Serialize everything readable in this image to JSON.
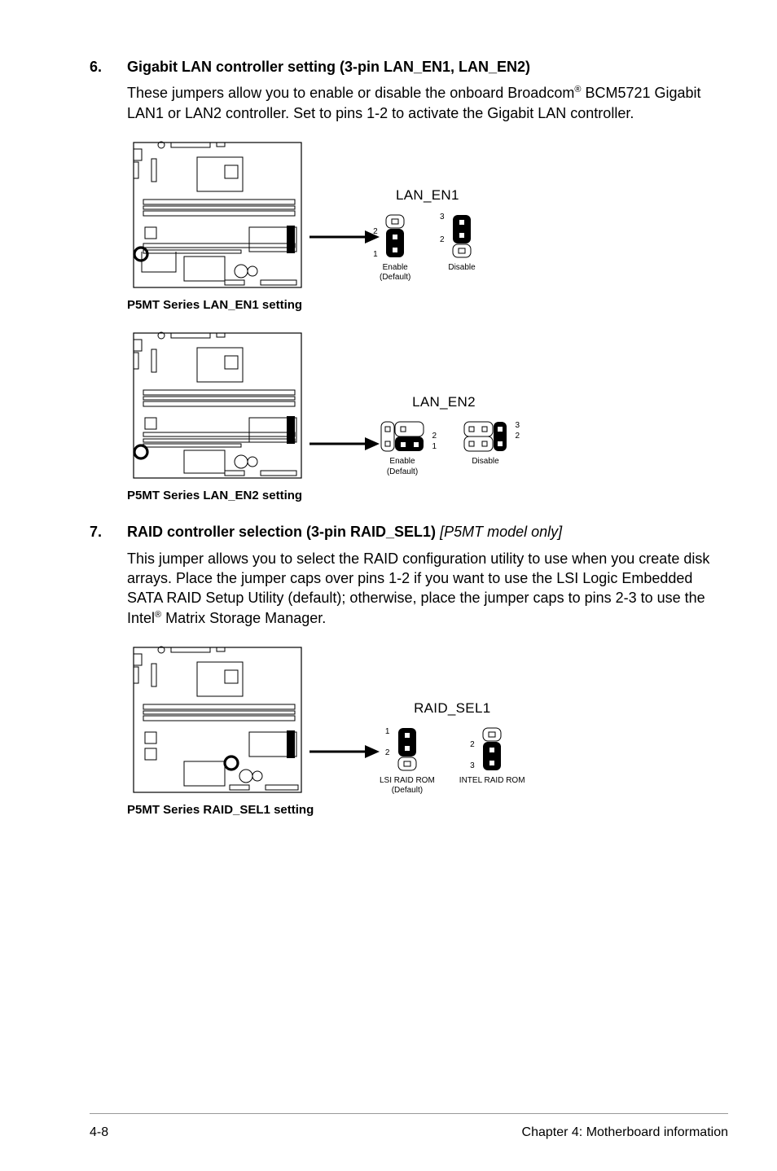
{
  "section6": {
    "num": "6.",
    "title": "Gigabit LAN controller setting (3-pin LAN_EN1, LAN_EN2)",
    "body_a": "These jumpers allow you to enable or disable the onboard Broadcom",
    "body_sup": "®",
    "body_b": " BCM5721 Gigabit LAN1 or LAN2 controller. Set to pins 1-2 to activate the Gigabit LAN controller.",
    "d1": {
      "header": "LAN_EN1",
      "enable_pins_top": "2",
      "enable_pins_bot": "1",
      "disable_pins_top": "3",
      "disable_pins_bot": "2",
      "enable_label_line1": "Enable",
      "enable_label_line2": "(Default)",
      "disable_label": "Disable",
      "caption": "P5MT Series LAN_EN1 setting"
    },
    "d2": {
      "header": "LAN_EN2",
      "enable_pins_top": "2",
      "enable_pins_bot": "1",
      "disable_pins_top": "3",
      "disable_pins_bot": "2",
      "enable_label_line1": "Enable",
      "enable_label_line2": "(Default)",
      "disable_label": "Disable",
      "caption": "P5MT Series LAN_EN2 setting"
    }
  },
  "section7": {
    "num": "7.",
    "title_a": "RAID controller selection (3-pin RAID_SEL1) ",
    "title_i": "[P5MT model only]",
    "body_a": "This jumper allows you to select the RAID configuration utility to use when you create disk arrays. Place the jumper caps over pins 1-2 if you want to use the LSI Logic Embedded SATA RAID Setup Utility (default); otherwise, place the jumper caps to pins 2-3 to use the Intel",
    "body_sup": "®",
    "body_b": " Matrix Storage Manager.",
    "d": {
      "header": "RAID_SEL1",
      "lsi_pins_top": "1",
      "lsi_pins_bot": "2",
      "intel_pins_top": "2",
      "intel_pins_bot": "3",
      "lsi_label_line1": "LSI RAID ROM",
      "lsi_label_line2": "(Default)",
      "intel_label": "INTEL RAID ROM",
      "caption": "P5MT Series RAID_SEL1 setting"
    }
  },
  "footer": {
    "left": "4-8",
    "right": "Chapter 4:  Motherboard information"
  }
}
